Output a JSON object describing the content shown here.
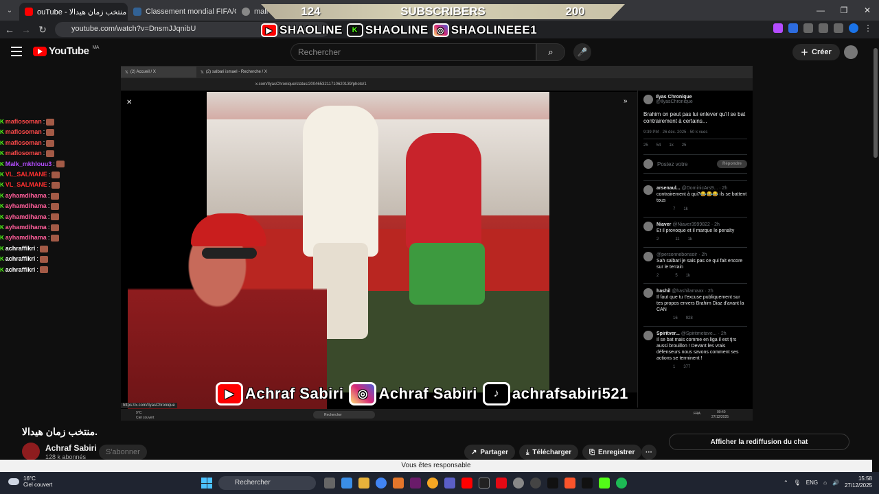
{
  "browser": {
    "tabs": [
      {
        "label": "ouTube - منتخب زمان هيدالا",
        "color": "#ff0000"
      },
      {
        "label": "Classement mondial FIFA/Coca",
        "color": "#326295"
      },
      {
        "label": "mali - R",
        "color": "#888888"
      }
    ],
    "url": "youtube.com/watch?v=DnsmJJqnibU"
  },
  "banner": {
    "left_count": "124",
    "center_label": "SUBSCRIBERS",
    "right_count": "200",
    "youtube": "SHAOLINE",
    "kick": "SHAOLINE",
    "instagram": "SHAOLINEEE1"
  },
  "youtube": {
    "logo": "YouTube",
    "region": "MA",
    "search_placeholder": "Rechercher",
    "create_label": "Créer"
  },
  "chat": [
    {
      "user": "mafiosoman",
      "color": "#ff4a4a"
    },
    {
      "user": "mafiosoman",
      "color": "#ff4a4a"
    },
    {
      "user": "mafiosoman",
      "color": "#ff4a4a"
    },
    {
      "user": "mafiosoman",
      "color": "#ff4a4a"
    },
    {
      "user": "Malk_mkhlouu3",
      "color": "#b44cff"
    },
    {
      "user": "VL_SALMANE",
      "color": "#ff3030"
    },
    {
      "user": "VL_SALMANE",
      "color": "#ff3030"
    },
    {
      "user": "ayhamdihama",
      "color": "#ff5e9a"
    },
    {
      "user": "ayhamdihama",
      "color": "#ff5e9a"
    },
    {
      "user": "ayhamdihama",
      "color": "#ff5e9a"
    },
    {
      "user": "ayhamdihama",
      "color": "#ff5e9a"
    },
    {
      "user": "ayhamdihama",
      "color": "#ff5e9a"
    },
    {
      "user": "achraffikri",
      "color": "#ffffff"
    },
    {
      "user": "achraffikri",
      "color": "#ffffff"
    },
    {
      "user": "achraffikri",
      "color": "#ffffff"
    }
  ],
  "inner": {
    "tab1": "(2) Accueil / X",
    "tab2": "(2) salbari ismael - Recherche / X",
    "url": "x.com/IlyasChronique/status/2004653211710620139/photo/1",
    "author": "Ilyas Chronique",
    "handle": "@IlyasChronique",
    "tweet": "Brahim on peut pas lui enlever qu'il se bat contrairement à certains...",
    "meta": "9:39 PM · 26 déc. 2025 · 50 k vues",
    "stats": [
      "25",
      "54",
      "1k",
      "25"
    ],
    "reply_prompt": "Postez votre",
    "reply_button": "Répondre",
    "replies": [
      {
        "name": "arsenaul...",
        "handle": "@DominicArs9... · 2h",
        "text": "contrairement à qui?😂😂😂 ils se battent tous",
        "stats": [
          "",
          "",
          "7",
          "1k"
        ]
      },
      {
        "name": "Niaver",
        "handle": "@Niaver3999822 · 2h",
        "text": "Et il provoque et il marque le penalty",
        "stats": [
          "2",
          "",
          "11",
          "1k"
        ]
      },
      {
        "name": "",
        "handle": "@personnebonsoir · 2h",
        "text": "Sah salbari je sais pas ce qui fait encore sur le terrain",
        "stats": [
          "2",
          "",
          "5",
          "1k"
        ]
      },
      {
        "name": "hashil",
        "handle": "@hashilamaax · 2h",
        "text": "Il faut que tu t'excuse publiquement sur tes propos envers Brahim Diaz d'avant la CAN",
        "stats": [
          "",
          "",
          "16",
          "928"
        ]
      },
      {
        "name": "Spiritver...",
        "handle": "@Spiritmetave... · 2h",
        "text": "Il se bat mais comme en liga il est tjrs aussi brouillon ! Devant les vrais défenseurs nous savons comment ses actions se terminent !",
        "stats": [
          "",
          "",
          "1",
          "377"
        ]
      }
    ],
    "hover_url": "https://x.com/IlyasChronique",
    "task_weather": "9°C",
    "task_weather_sub": "Ciel couvert",
    "task_search": "Rechercher",
    "task_time": "00:40",
    "task_date": "27/12/2025",
    "task_lang": "FRA"
  },
  "overlay": {
    "youtube": "Achraf Sabiri",
    "instagram": "Achraf Sabiri",
    "tiktok": "achrafsabiri521"
  },
  "video": {
    "title": "منتخب زمان هيدالا.",
    "channel": "Achraf Sabiri",
    "subs": "128 k abonnés",
    "subscribe": "S'abonner",
    "share": "Partager",
    "download": "Télécharger",
    "save": "Enregistrer",
    "more": "···",
    "chat_replay": "Afficher la rediffusion du chat"
  },
  "toast": "Vous êtes responsable",
  "taskbar": {
    "temp": "16°C",
    "weather": "Ciel couvert",
    "search": "Rechercher",
    "lang": "ENG",
    "time": "15:58",
    "date": "27/12/2025"
  }
}
